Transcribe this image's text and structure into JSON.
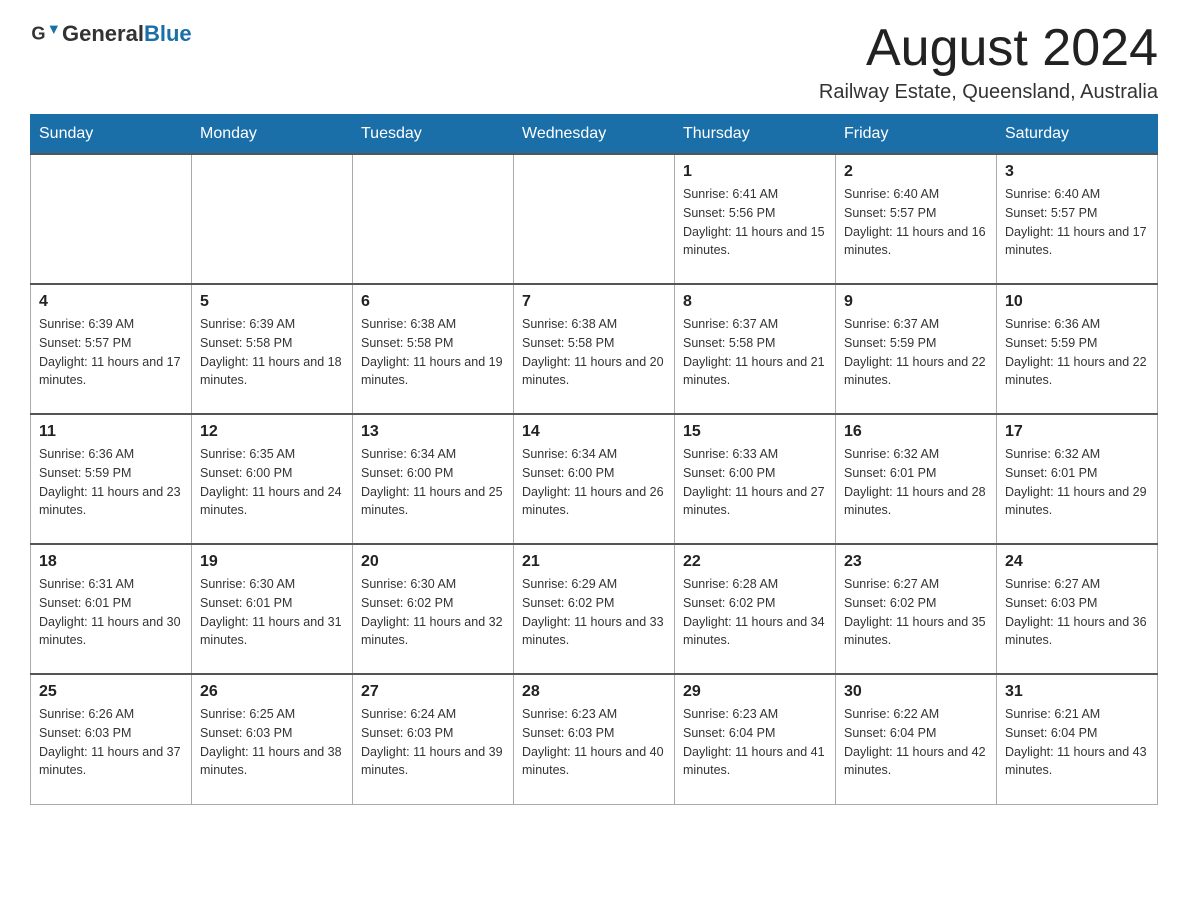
{
  "header": {
    "logo_general": "General",
    "logo_blue": "Blue",
    "month_year": "August 2024",
    "location": "Railway Estate, Queensland, Australia"
  },
  "days_of_week": [
    "Sunday",
    "Monday",
    "Tuesday",
    "Wednesday",
    "Thursday",
    "Friday",
    "Saturday"
  ],
  "weeks": [
    [
      {
        "day": "",
        "info": ""
      },
      {
        "day": "",
        "info": ""
      },
      {
        "day": "",
        "info": ""
      },
      {
        "day": "",
        "info": ""
      },
      {
        "day": "1",
        "info": "Sunrise: 6:41 AM\nSunset: 5:56 PM\nDaylight: 11 hours and 15 minutes."
      },
      {
        "day": "2",
        "info": "Sunrise: 6:40 AM\nSunset: 5:57 PM\nDaylight: 11 hours and 16 minutes."
      },
      {
        "day": "3",
        "info": "Sunrise: 6:40 AM\nSunset: 5:57 PM\nDaylight: 11 hours and 17 minutes."
      }
    ],
    [
      {
        "day": "4",
        "info": "Sunrise: 6:39 AM\nSunset: 5:57 PM\nDaylight: 11 hours and 17 minutes."
      },
      {
        "day": "5",
        "info": "Sunrise: 6:39 AM\nSunset: 5:58 PM\nDaylight: 11 hours and 18 minutes."
      },
      {
        "day": "6",
        "info": "Sunrise: 6:38 AM\nSunset: 5:58 PM\nDaylight: 11 hours and 19 minutes."
      },
      {
        "day": "7",
        "info": "Sunrise: 6:38 AM\nSunset: 5:58 PM\nDaylight: 11 hours and 20 minutes."
      },
      {
        "day": "8",
        "info": "Sunrise: 6:37 AM\nSunset: 5:58 PM\nDaylight: 11 hours and 21 minutes."
      },
      {
        "day": "9",
        "info": "Sunrise: 6:37 AM\nSunset: 5:59 PM\nDaylight: 11 hours and 22 minutes."
      },
      {
        "day": "10",
        "info": "Sunrise: 6:36 AM\nSunset: 5:59 PM\nDaylight: 11 hours and 22 minutes."
      }
    ],
    [
      {
        "day": "11",
        "info": "Sunrise: 6:36 AM\nSunset: 5:59 PM\nDaylight: 11 hours and 23 minutes."
      },
      {
        "day": "12",
        "info": "Sunrise: 6:35 AM\nSunset: 6:00 PM\nDaylight: 11 hours and 24 minutes."
      },
      {
        "day": "13",
        "info": "Sunrise: 6:34 AM\nSunset: 6:00 PM\nDaylight: 11 hours and 25 minutes."
      },
      {
        "day": "14",
        "info": "Sunrise: 6:34 AM\nSunset: 6:00 PM\nDaylight: 11 hours and 26 minutes."
      },
      {
        "day": "15",
        "info": "Sunrise: 6:33 AM\nSunset: 6:00 PM\nDaylight: 11 hours and 27 minutes."
      },
      {
        "day": "16",
        "info": "Sunrise: 6:32 AM\nSunset: 6:01 PM\nDaylight: 11 hours and 28 minutes."
      },
      {
        "day": "17",
        "info": "Sunrise: 6:32 AM\nSunset: 6:01 PM\nDaylight: 11 hours and 29 minutes."
      }
    ],
    [
      {
        "day": "18",
        "info": "Sunrise: 6:31 AM\nSunset: 6:01 PM\nDaylight: 11 hours and 30 minutes."
      },
      {
        "day": "19",
        "info": "Sunrise: 6:30 AM\nSunset: 6:01 PM\nDaylight: 11 hours and 31 minutes."
      },
      {
        "day": "20",
        "info": "Sunrise: 6:30 AM\nSunset: 6:02 PM\nDaylight: 11 hours and 32 minutes."
      },
      {
        "day": "21",
        "info": "Sunrise: 6:29 AM\nSunset: 6:02 PM\nDaylight: 11 hours and 33 minutes."
      },
      {
        "day": "22",
        "info": "Sunrise: 6:28 AM\nSunset: 6:02 PM\nDaylight: 11 hours and 34 minutes."
      },
      {
        "day": "23",
        "info": "Sunrise: 6:27 AM\nSunset: 6:02 PM\nDaylight: 11 hours and 35 minutes."
      },
      {
        "day": "24",
        "info": "Sunrise: 6:27 AM\nSunset: 6:03 PM\nDaylight: 11 hours and 36 minutes."
      }
    ],
    [
      {
        "day": "25",
        "info": "Sunrise: 6:26 AM\nSunset: 6:03 PM\nDaylight: 11 hours and 37 minutes."
      },
      {
        "day": "26",
        "info": "Sunrise: 6:25 AM\nSunset: 6:03 PM\nDaylight: 11 hours and 38 minutes."
      },
      {
        "day": "27",
        "info": "Sunrise: 6:24 AM\nSunset: 6:03 PM\nDaylight: 11 hours and 39 minutes."
      },
      {
        "day": "28",
        "info": "Sunrise: 6:23 AM\nSunset: 6:03 PM\nDaylight: 11 hours and 40 minutes."
      },
      {
        "day": "29",
        "info": "Sunrise: 6:23 AM\nSunset: 6:04 PM\nDaylight: 11 hours and 41 minutes."
      },
      {
        "day": "30",
        "info": "Sunrise: 6:22 AM\nSunset: 6:04 PM\nDaylight: 11 hours and 42 minutes."
      },
      {
        "day": "31",
        "info": "Sunrise: 6:21 AM\nSunset: 6:04 PM\nDaylight: 11 hours and 43 minutes."
      }
    ]
  ]
}
